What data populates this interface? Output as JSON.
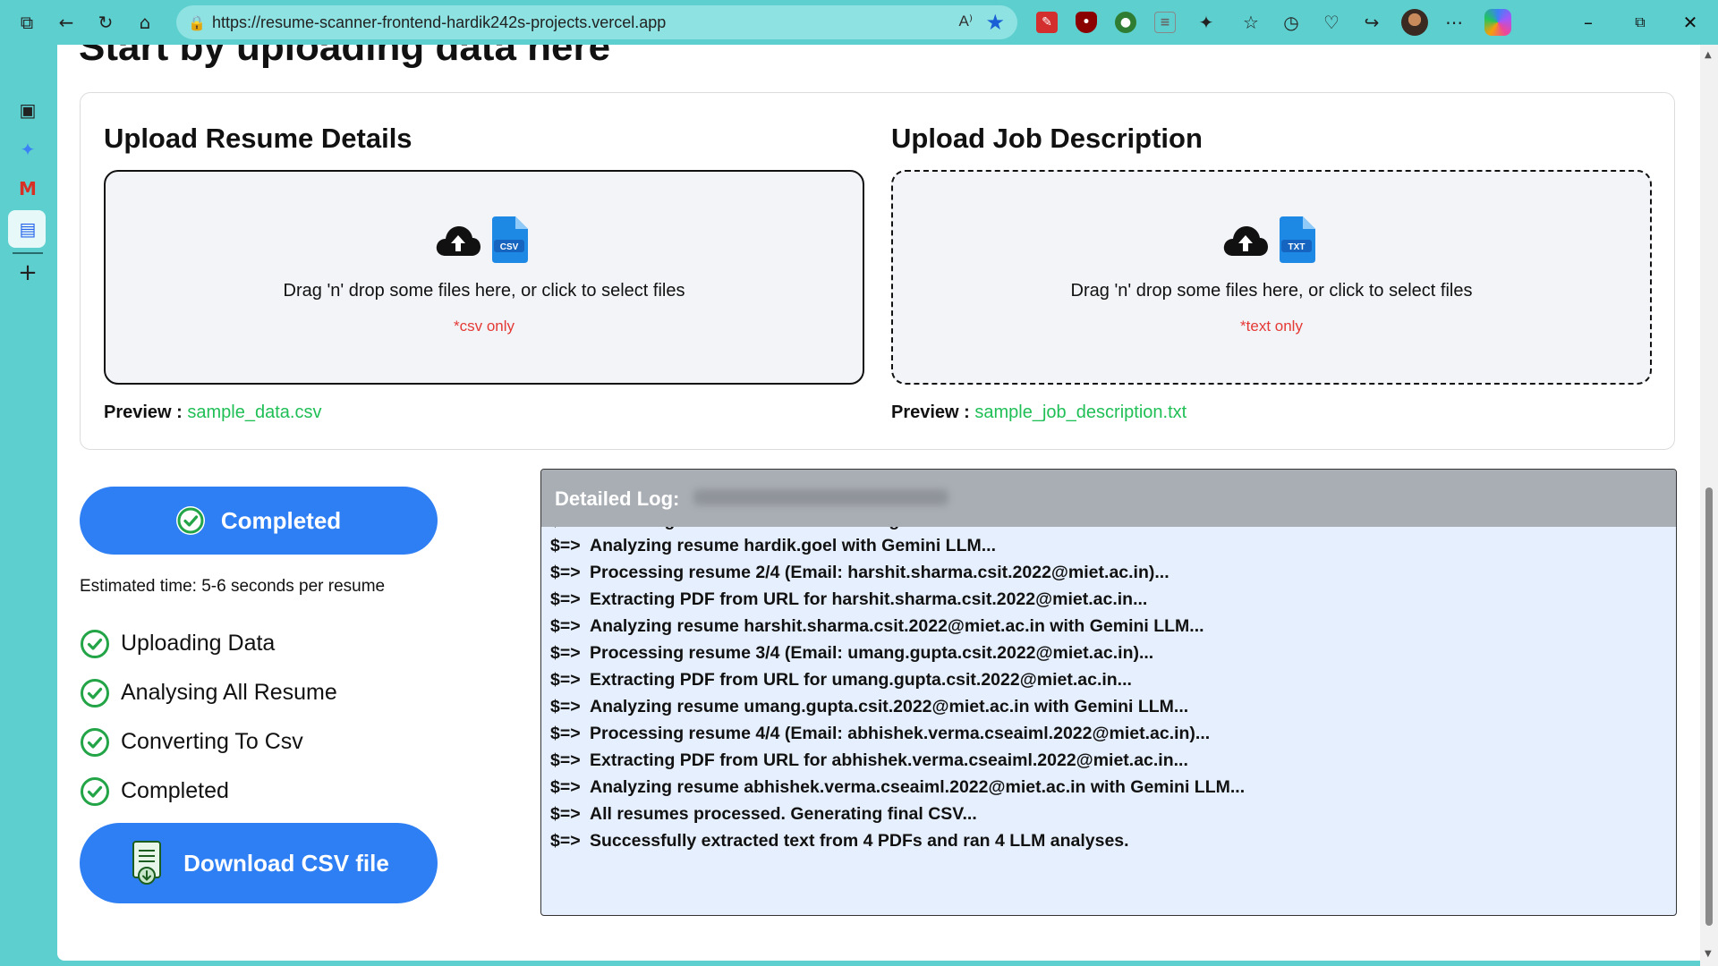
{
  "browser": {
    "url": "https://resume-scanner-frontend-hardik242s-projects.vercel.app",
    "read_aloud": "A⁾"
  },
  "page": {
    "heading": "Start by uploading data here"
  },
  "upload": {
    "resume": {
      "title": "Upload Resume Details",
      "instructions": "Drag 'n' drop some files here, or click to select files",
      "note": "*csv only",
      "file_badge": "CSV",
      "preview_label": "Preview :",
      "preview_file": "sample_data.csv"
    },
    "job": {
      "title": "Upload Job Description",
      "instructions": "Drag 'n' drop some files here, or click to select files",
      "note": "*text only",
      "file_badge": "TXT",
      "preview_label": "Preview :",
      "preview_file": "sample_job_description.txt"
    }
  },
  "progress": {
    "status_label": "Completed",
    "estimate": "Estimated time: 5-6 seconds per resume",
    "steps": [
      {
        "label": "Uploading Data",
        "done": true
      },
      {
        "label": "Analysing All Resume",
        "done": true
      },
      {
        "label": "Converting To Csv",
        "done": true
      },
      {
        "label": "Completed",
        "done": true
      }
    ],
    "download_label": "Download CSV file"
  },
  "log": {
    "title": "Detailed Log:",
    "prefix": "$=>",
    "partial_first": "Extracting PDF from URL for hardik.goel...",
    "lines": [
      "Analyzing resume hardik.goel with Gemini LLM...",
      "Processing resume 2/4 (Email: harshit.sharma.csit.2022@miet.ac.in)...",
      "Extracting PDF from URL for harshit.sharma.csit.2022@miet.ac.in...",
      "Analyzing resume harshit.sharma.csit.2022@miet.ac.in with Gemini LLM...",
      "Processing resume 3/4 (Email: umang.gupta.csit.2022@miet.ac.in)...",
      "Extracting PDF from URL for umang.gupta.csit.2022@miet.ac.in...",
      "Analyzing resume umang.gupta.csit.2022@miet.ac.in with Gemini LLM...",
      "Processing resume 4/4 (Email: abhishek.verma.cseaiml.2022@miet.ac.in)...",
      "Extracting PDF from URL for abhishek.verma.cseaiml.2022@miet.ac.in...",
      "Analyzing resume abhishek.verma.cseaiml.2022@miet.ac.in with Gemini LLM...",
      "All resumes processed. Generating final CSV...",
      "Successfully extracted text from 4 PDFs and ran 4 LLM analyses."
    ]
  },
  "colors": {
    "accent_blue": "#2f7ff4",
    "success_green": "#1fbf56",
    "note_red": "#e53935",
    "chrome_teal": "#5ecfcf"
  }
}
